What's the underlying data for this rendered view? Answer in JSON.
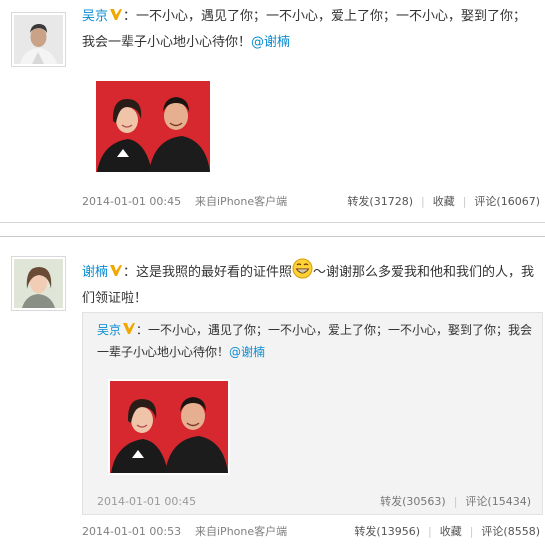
{
  "post1": {
    "author": "吴京",
    "text": "：一不小心，遇见了你；一不小心，爱上了你；一不小心，娶到了你；我会一辈子小心地小心待你！",
    "mention": "@谢楠",
    "time": "2014-01-01 00:45",
    "source": "来自iPhone客户端",
    "repost": "转发(31728)",
    "favorite": "收藏",
    "comment": "评论(16067)"
  },
  "post2": {
    "author": "谢楠",
    "text_before_emoji": "：这是我照的最好看的证件照",
    "text_after_emoji": "～谢谢那么多爱我和他和我们的人，我们领证啦！",
    "time": "2014-01-01 00:53",
    "source": "来自iPhone客户端",
    "repost": "转发(13956)",
    "favorite": "收藏",
    "comment": "评论(8558)",
    "quoted": {
      "author": "吴京",
      "text": "：一不小心，遇见了你；一不小心，爱上了你；一不小心，娶到了你；我会一辈子小心地小心待你！",
      "mention": "@谢楠",
      "time": "2014-01-01 00:45",
      "repost": "转发(30563)",
      "comment": "评论(15434)"
    }
  },
  "icons": {
    "verified": "verified-v-icon",
    "emoji": "grin-emoji-icon"
  },
  "colors": {
    "link": "#0a8cd2",
    "verified": "#f0a800",
    "photo_background": "#d8282f"
  }
}
